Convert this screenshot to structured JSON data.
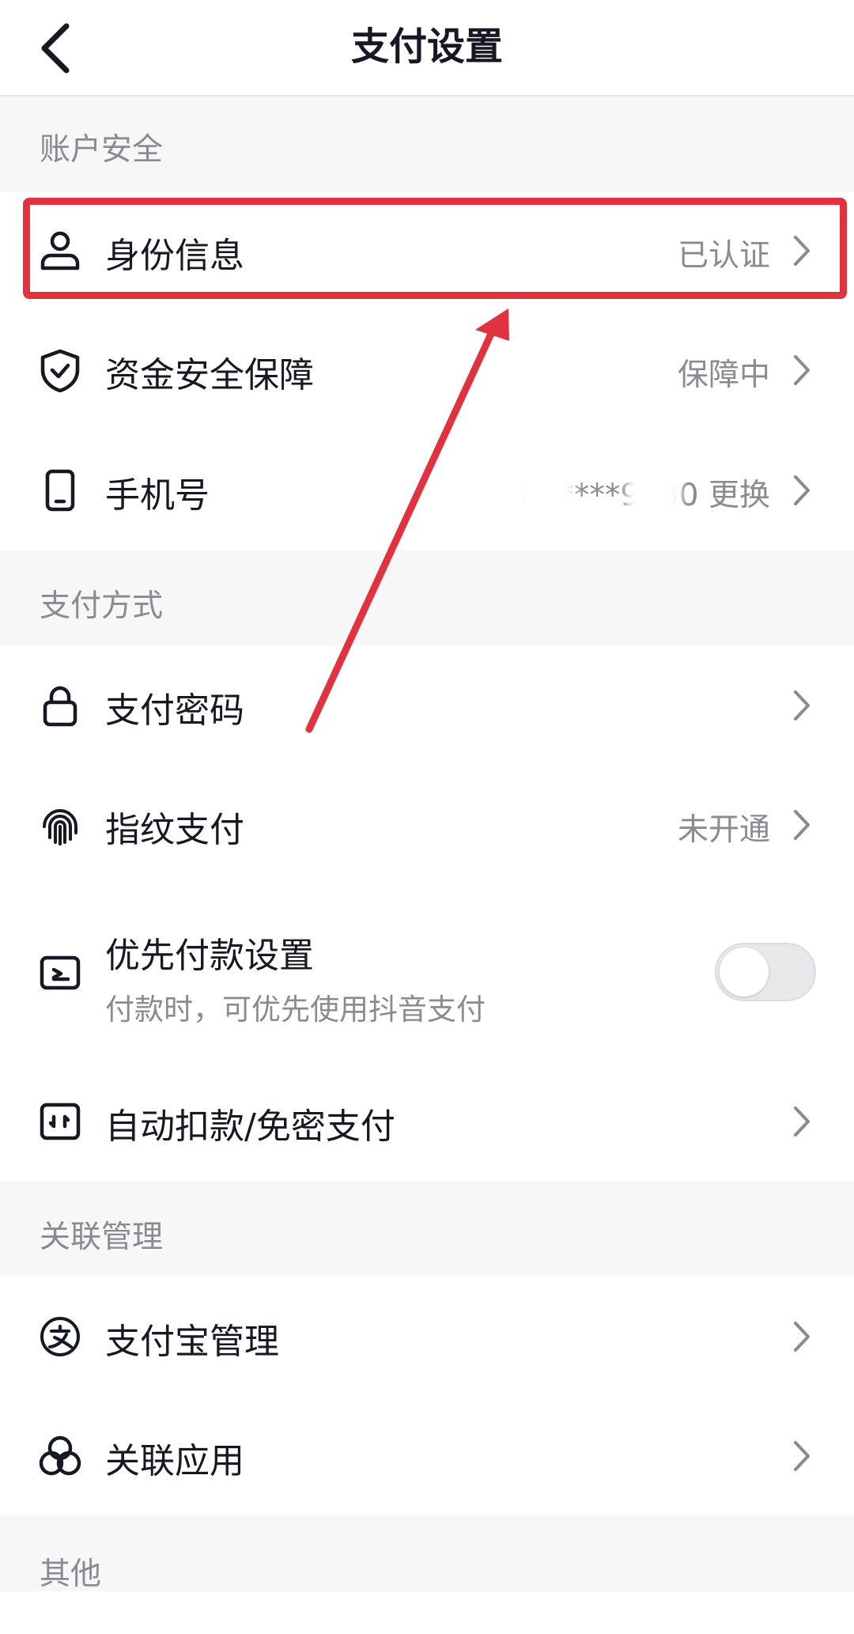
{
  "header": {
    "title": "支付设置",
    "back_icon": "chevron-left-icon"
  },
  "sections": {
    "account_security": {
      "title": "账户安全",
      "identity": {
        "label": "身份信息",
        "value": "已认证",
        "icon": "user-icon"
      },
      "fund_security": {
        "label": "资金安全保障",
        "value": "保障中",
        "icon": "shield-check-icon"
      },
      "phone": {
        "label": "手机号",
        "value": "87****9830 更换",
        "icon": "phone-icon"
      }
    },
    "payment_methods": {
      "title": "支付方式",
      "password": {
        "label": "支付密码",
        "icon": "lock-icon"
      },
      "fingerprint": {
        "label": "指纹支付",
        "value": "未开通",
        "icon": "fingerprint-icon"
      },
      "priority": {
        "label": "优先付款设置",
        "sub": "付款时，可优先使用抖音支付",
        "icon": "card-priority-icon",
        "toggle_on": false
      },
      "auto_debit": {
        "label": "自动扣款/免密支付",
        "icon": "auto-pay-icon"
      }
    },
    "linked": {
      "title": "关联管理",
      "alipay": {
        "label": "支付宝管理",
        "icon": "alipay-icon"
      },
      "apps": {
        "label": "关联应用",
        "icon": "linked-apps-icon"
      }
    },
    "other": {
      "title": "其他"
    }
  },
  "colors": {
    "accent_red": "#e1323f",
    "text_primary": "#161823",
    "text_secondary": "#8a8b91",
    "section_bg": "#f7f7f8"
  }
}
